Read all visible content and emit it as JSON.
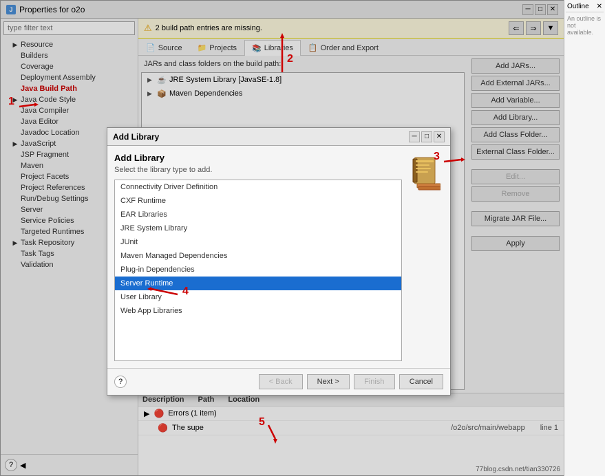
{
  "window": {
    "title": "Properties for o2o",
    "minimize_label": "─",
    "maximize_label": "□",
    "close_label": "✕"
  },
  "sidebar": {
    "filter_placeholder": "type filter text",
    "items": [
      {
        "label": "Resource",
        "expandable": true,
        "level": 1
      },
      {
        "label": "Builders",
        "expandable": false,
        "level": 1
      },
      {
        "label": "Coverage",
        "expandable": false,
        "level": 1
      },
      {
        "label": "Deployment Assembly",
        "expandable": false,
        "level": 1
      },
      {
        "label": "Java Build Path",
        "expandable": false,
        "level": 1,
        "highlighted": true
      },
      {
        "label": "Java Code Style",
        "expandable": true,
        "level": 1
      },
      {
        "label": "Java Compiler",
        "expandable": false,
        "level": 1
      },
      {
        "label": "Java Editor",
        "expandable": false,
        "level": 1
      },
      {
        "label": "Javadoc Location",
        "expandable": false,
        "level": 1
      },
      {
        "label": "JavaScript",
        "expandable": true,
        "level": 1
      },
      {
        "label": "JSP Fragment",
        "expandable": false,
        "level": 1
      },
      {
        "label": "Maven",
        "expandable": false,
        "level": 1
      },
      {
        "label": "Project Facets",
        "expandable": false,
        "level": 1
      },
      {
        "label": "Project References",
        "expandable": false,
        "level": 1
      },
      {
        "label": "Run/Debug Settings",
        "expandable": false,
        "level": 1
      },
      {
        "label": "Server",
        "expandable": false,
        "level": 1
      },
      {
        "label": "Service Policies",
        "expandable": false,
        "level": 1
      },
      {
        "label": "Targeted Runtimes",
        "expandable": false,
        "level": 1
      },
      {
        "label": "Task Repository",
        "expandable": false,
        "level": 1
      },
      {
        "label": "Task Tags",
        "expandable": false,
        "level": 1
      },
      {
        "label": "Validation",
        "expandable": false,
        "level": 1
      }
    ],
    "help_label": "?"
  },
  "warning": {
    "text": "2 build path entries are missing.",
    "icon": "⚠"
  },
  "tabs": [
    {
      "label": "Source",
      "icon": "📄"
    },
    {
      "label": "Projects",
      "icon": "📁"
    },
    {
      "label": "Libraries",
      "icon": "📚",
      "active": true
    },
    {
      "label": "Order and Export",
      "icon": "📋"
    }
  ],
  "build_path": {
    "description": "JARs and class folders on the build path:",
    "items": [
      {
        "label": "JRE System Library [JavaSE-1.8]",
        "expandable": true
      },
      {
        "label": "Maven Dependencies",
        "expandable": true
      }
    ]
  },
  "right_buttons": {
    "add_jars": "Add JARs...",
    "add_external_jars": "Add External JARs...",
    "add_variable": "Add Variable...",
    "add_library": "Add Library...",
    "add_class_folder": "Add Class Folder...",
    "external_class_folder": "External Class Folder...",
    "edit": "Edit...",
    "remove": "Remove",
    "migrate_jar": "Migrate JAR File...",
    "apply": "Apply"
  },
  "bottom": {
    "description_label": "Description",
    "path_label": "Path",
    "location_label": "Location",
    "error_group": "Errors (1 item)",
    "error_text": "The supe",
    "error_path": "/o2o/src/main/webapp",
    "error_location": "line 1"
  },
  "modal": {
    "title": "Add Library",
    "heading": "Add Library",
    "subtext": "Select the library type to add.",
    "minimize_label": "─",
    "maximize_label": "□",
    "close_label": "✕",
    "libraries": [
      {
        "label": "Connectivity Driver Definition",
        "selected": false
      },
      {
        "label": "CXF Runtime",
        "selected": false
      },
      {
        "label": "EAR Libraries",
        "selected": false
      },
      {
        "label": "JRE System Library",
        "selected": false
      },
      {
        "label": "JUnit",
        "selected": false
      },
      {
        "label": "Maven Managed Dependencies",
        "selected": false
      },
      {
        "label": "Plug-in Dependencies",
        "selected": false
      },
      {
        "label": "Server Runtime",
        "selected": true
      },
      {
        "label": "User Library",
        "selected": false
      },
      {
        "label": "Web App Libraries",
        "selected": false
      }
    ],
    "back_btn": "< Back",
    "next_btn": "Next >",
    "finish_btn": "Finish",
    "cancel_btn": "Cancel"
  },
  "steps": {
    "step1": "1",
    "step2": "2",
    "step3": "3",
    "step4": "4",
    "step5": "5"
  },
  "outline": {
    "title": "Outline",
    "close_label": "✕",
    "note": "An outline is not available."
  },
  "watermark": "77blog.csdn.net/tian330726"
}
